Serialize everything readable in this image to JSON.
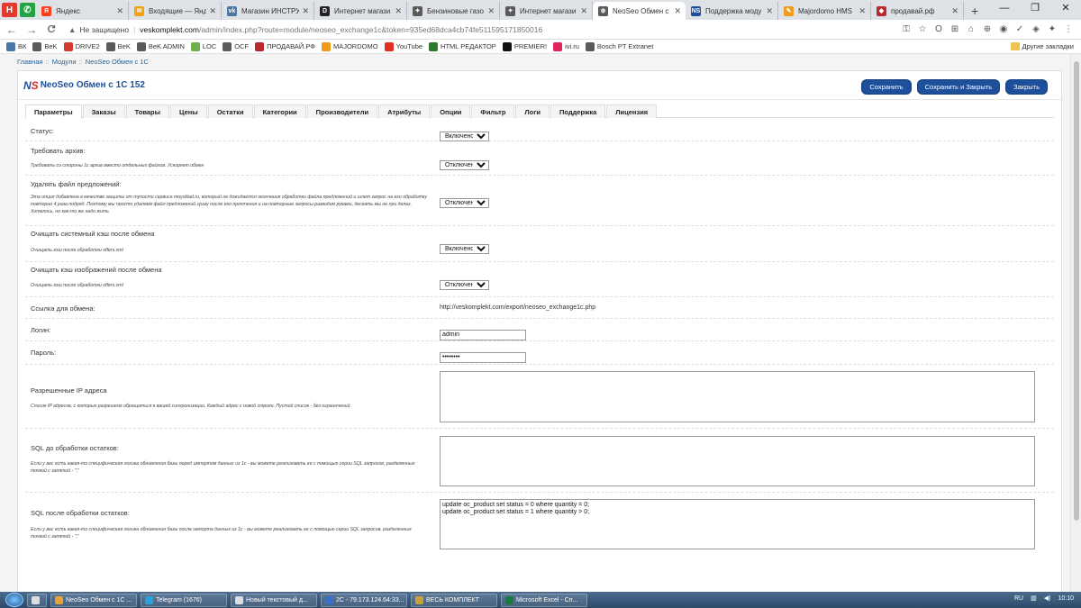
{
  "browser": {
    "pinned": [
      {
        "label": "H",
        "color": "#e23b2e"
      },
      {
        "label": "✆",
        "color": "#25a244"
      }
    ],
    "tabs": [
      {
        "title": "Яндекс",
        "fav": "Я",
        "color": "#fc3f1d",
        "active": false
      },
      {
        "title": "Входящие — Янд",
        "fav": "✉",
        "color": "#f0a30a",
        "active": false
      },
      {
        "title": "Магазин ИНСТРУ",
        "fav": "vk",
        "color": "#4a76a8",
        "active": false
      },
      {
        "title": "Интернет магази",
        "fav": "D",
        "color": "#222222",
        "active": false
      },
      {
        "title": "Бензиновые газо",
        "fav": "✦",
        "color": "#5a5a5a",
        "active": false
      },
      {
        "title": "Интернет магази",
        "fav": "✦",
        "color": "#5a5a5a",
        "active": false
      },
      {
        "title": "NeoSeo Обмен с 1",
        "fav": "⊕",
        "color": "#5a5a5a",
        "active": true
      },
      {
        "title": "Поддержка моду",
        "fav": "NS",
        "color": "#1e4f9c",
        "active": false
      },
      {
        "title": "Majordomo HMS",
        "fav": "✎",
        "color": "#f09c1a",
        "active": false
      },
      {
        "title": "продавай.рф",
        "fav": "◆",
        "color": "#b8282c",
        "active": false
      }
    ],
    "new_tab": "+",
    "window_buttons": [
      "—",
      "❐",
      "✕"
    ],
    "nav": {
      "back": "←",
      "forward": "→",
      "reload": "C"
    },
    "url": {
      "warning": "Не защищено",
      "host": "veskomplekt.com",
      "path": "/admin/index.php?route=module/neoseo_exchange1c&token=935ed68dca4cb74fe511595171850016"
    },
    "extension_icons": [
      "⚿",
      "☆",
      "O",
      "⊞",
      "⌂",
      "⊕",
      "◉",
      "✓",
      "◈",
      "✦",
      "⋮"
    ],
    "bookmarks": [
      {
        "label": "ВК",
        "color": "#4a76a8"
      },
      {
        "label": "BeK",
        "color": "#5a5a5a"
      },
      {
        "label": "DRIVE2",
        "color": "#d23b2e"
      },
      {
        "label": "BeK",
        "color": "#5a5a5a"
      },
      {
        "label": "BeK ADMIN",
        "color": "#5a5a5a"
      },
      {
        "label": "LOC",
        "color": "#6ab04c"
      },
      {
        "label": "OCF",
        "color": "#5a5a5a"
      },
      {
        "label": "ПРОДАВАЙ.РФ",
        "color": "#b8282c"
      },
      {
        "label": "MAJORDOMO",
        "color": "#f09c1a"
      },
      {
        "label": "YouTube",
        "color": "#e52d27"
      },
      {
        "label": "HTML РЕДАКТОР",
        "color": "#2d7a2d"
      },
      {
        "label": "PREMIER!",
        "color": "#111111"
      },
      {
        "label": "ivi.ru",
        "color": "#e0245e"
      },
      {
        "label": "Bosch PT Extranet",
        "color": "#5a5a5a"
      }
    ],
    "other_bookmarks": "Другие закладки"
  },
  "page": {
    "breadcrumb": [
      "Главная",
      "Модули",
      "NeoSeo Обмен с 1С"
    ],
    "logo": {
      "n": "N",
      "s": "S"
    },
    "title": "NeoSeo Обмен с 1С 152",
    "buttons": {
      "save": "Сохранить",
      "save_close": "Сохранить и Закрыть",
      "close": "Закрыть"
    },
    "tabs": [
      "Параметры",
      "Заказы",
      "Товары",
      "Цены",
      "Остатки",
      "Категории",
      "Производители",
      "Атрибуты",
      "Опции",
      "Фильтр",
      "Логи",
      "Поддержка",
      "Лицензия"
    ],
    "active_tab": 0,
    "fields": {
      "status": {
        "label": "Статус:",
        "value": "Включено"
      },
      "require_archive": {
        "label": "Требовать архив:",
        "help": "Требовать со стороны 1с архив вместо отдельных файлов. Ускоряет обмен",
        "value": "Отключено"
      },
      "delete_offers": {
        "label": "Удалять файл предложений:",
        "help": "Эта опция добавлена в качестве защиты от тупости сервиса moysklad.ru, который не дожидается окончания обработки файла предложений и шлет запрос на его обработку повторно 4 раза подряд. Поэтому мы просто удаляем файл предложений сразу после его прочтения и на повторные запросы разводим руками, дескать мы не при делах. Хотелось, но как-то же надо жить",
        "value": "Отключено"
      },
      "clear_system_cache": {
        "label": "Очищать системный кэш после обмена",
        "help": "Очищать кэш после обработки offers.xml",
        "value": "Включено"
      },
      "clear_image_cache": {
        "label": "Очищать кэш изображений после обмена",
        "help": "Очищать кэш после обработки offers.xml",
        "value": "Отключено"
      },
      "exchange_link": {
        "label": "Ссылка для обмена:",
        "value": "http://veskomplekt.com/export/neoseo_exchange1c.php"
      },
      "login": {
        "label": "Логин:",
        "value": "admin"
      },
      "password": {
        "label": "Пароль:",
        "value": "password"
      },
      "allowed_ip": {
        "label": "Разрешенные IP адреса",
        "help": "Список IP адресов, с которых разрешено обращаться к вашей синхронизации. Каждый адрес с новой строки. Пустой список - без ограничений.",
        "value": ""
      },
      "sql_before": {
        "label": "SQL до обработки остатков:",
        "help": "Если у вас есть какая-то специфическая логика обновления базы перед импортом данных из 1с - вы можете реализовать ее с помощью серии SQL запросов, разделенных точкой с запятой - \";\"",
        "value": ""
      },
      "sql_after": {
        "label": "SQL после обработки остатков:",
        "help": "Если у вас есть какая-то специфическая логика обновления базы после импорта данных из 1с - вы можете реализовать ее с помощью серии SQL запросов, разделенных точкой с запятой - \";\"",
        "value": "update oc_product set status = 0 where quantity = 0;\nupdate oc_product set status = 1 where quantity > 0;"
      }
    },
    "options": [
      "Включено",
      "Отключено"
    ]
  },
  "taskbar": {
    "items": [
      {
        "label": "",
        "color": "#dddddd"
      },
      {
        "label": "NeoSeo Обмен с 1С ...",
        "color": "#e8a23a"
      },
      {
        "label": "Telegram (1676)",
        "color": "#2aa3dd"
      },
      {
        "label": "Новый текстовый д...",
        "color": "#dddddd"
      },
      {
        "label": "2С - 79.173.124.64:33...",
        "color": "#3a6fc9"
      },
      {
        "label": "ВЕСЬ КОМПЛЕКТ",
        "color": "#c9a03a"
      },
      {
        "label": "Microsoft Excel - Сп...",
        "color": "#1f7a3f"
      }
    ],
    "lang": "RU",
    "time": "10:10"
  }
}
